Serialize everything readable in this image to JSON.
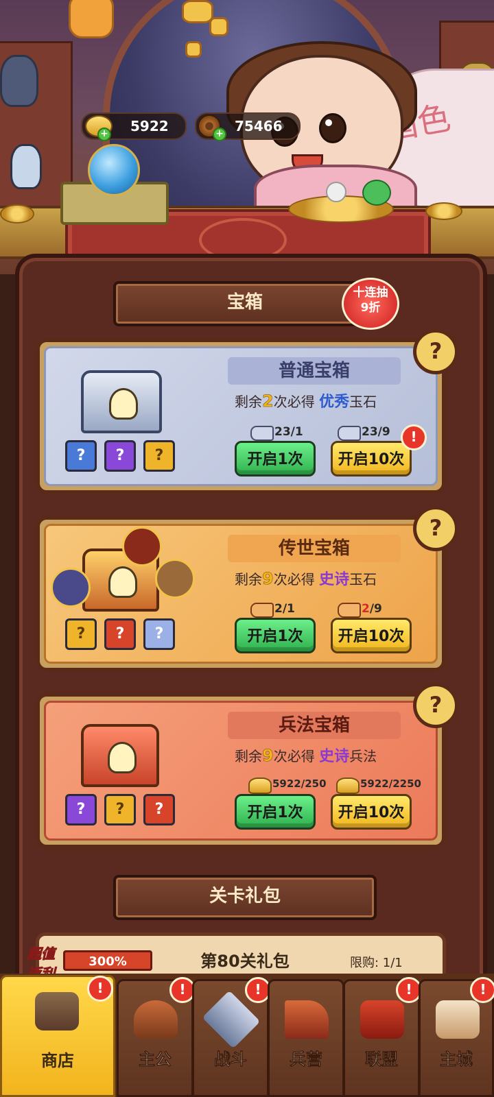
{
  "currency": {
    "gold": "5922",
    "coins": "75466"
  },
  "scene": {
    "fan_text": "国色"
  },
  "chest_section": {
    "title": "宝箱",
    "badge_line1": "十连抽",
    "badge_line2": "9折"
  },
  "chests": [
    {
      "name": "普通宝箱",
      "desc_prefix": "剩余",
      "count": "2",
      "desc_mid": "次必得",
      "quality": "优秀",
      "reward": "玉石",
      "cost1": "23/1",
      "cost10": "23/9",
      "btn1": "开启1次",
      "btn10": "开启10次"
    },
    {
      "name": "传世宝箱",
      "desc_prefix": "剩余",
      "count": "9",
      "desc_mid": "次必得",
      "quality": "史诗",
      "reward": "玉石",
      "cost1": "2/1",
      "cost10_have": "2",
      "cost10_need": "/9",
      "btn1": "开启1次",
      "btn10": "开启10次"
    },
    {
      "name": "兵法宝箱",
      "desc_prefix": "剩余",
      "count": "9",
      "desc_mid": "次必得",
      "quality": "史诗",
      "reward": "兵法",
      "cost1": "5922/250",
      "cost10": "5922/2250",
      "btn1": "开启1次",
      "btn10": "开启10次"
    }
  ],
  "gift_section": {
    "title": "关卡礼包",
    "tag_line1": "超值",
    "tag_line2": "返利",
    "percent": "300%",
    "pack_title": "第80关礼包",
    "limit": "限购: 1/1"
  },
  "nav": [
    {
      "label": "商店"
    },
    {
      "label": "主公"
    },
    {
      "label": "战斗"
    },
    {
      "label": "兵营"
    },
    {
      "label": "联盟"
    },
    {
      "label": "主城"
    }
  ],
  "icons": {
    "help": "?",
    "alert": "!",
    "plus": "+"
  }
}
